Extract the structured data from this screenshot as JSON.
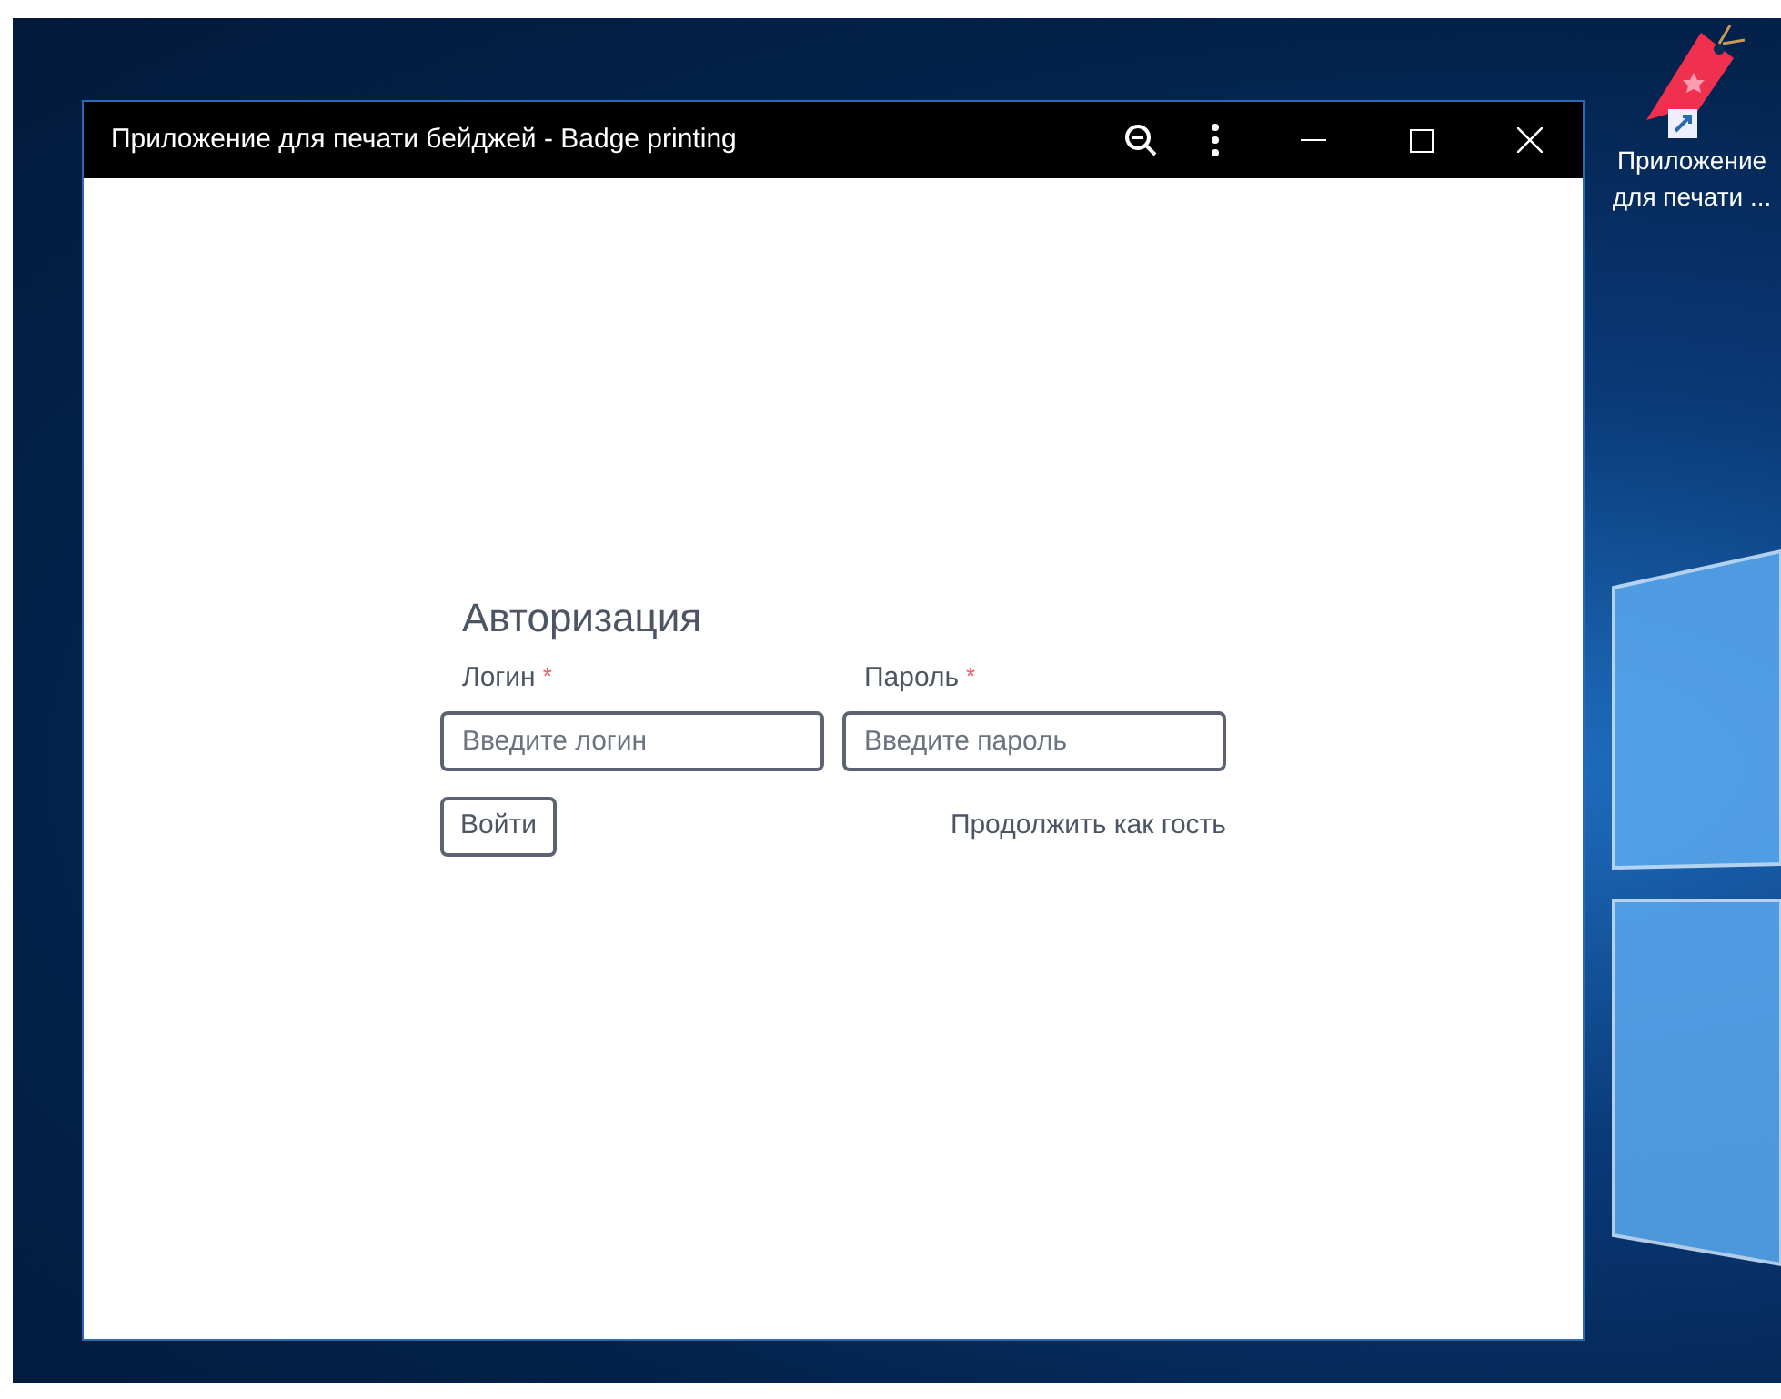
{
  "window": {
    "title": "Приложение для печати бейджей - Badge printing"
  },
  "form": {
    "title": "Авторизация",
    "fields": [
      {
        "label": "Логин",
        "required_mark": "*",
        "placeholder": "Введите логин"
      },
      {
        "label": "Пароль",
        "required_mark": "*",
        "placeholder": "Введите пароль"
      }
    ],
    "submit_button": "Войти",
    "guest_link": "Продолжить как гость"
  },
  "desktop_icon": {
    "label": "Приложение для печати ..."
  }
}
